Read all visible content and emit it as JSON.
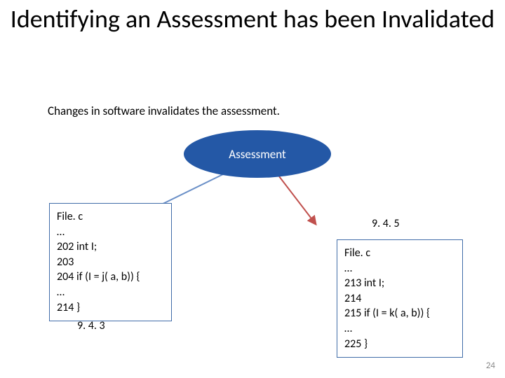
{
  "title": "Identifying an Assessment has been Invalidated",
  "subtitle": "Changes in software invalidates the assessment.",
  "ellipse_label": "Assessment",
  "left_box": {
    "lines": [
      "File. c",
      "…",
      "202 int I;",
      "203",
      "204 if (I = j( a, b)) {",
      "…",
      "214 }"
    ]
  },
  "right_box": {
    "lines": [
      "File. c",
      "…",
      "213 int I;",
      "214",
      "215 if (I = k( a, b)) {",
      "…",
      "225 }"
    ]
  },
  "ref_left": "9. 4. 3",
  "ref_right": "9. 4. 5",
  "page_number": "24",
  "colors": {
    "ellipse_fill": "#2458a6",
    "box_border": "#406ca8",
    "arrow_blue": "#6a8fc7",
    "arrow_red": "#c0504d"
  }
}
